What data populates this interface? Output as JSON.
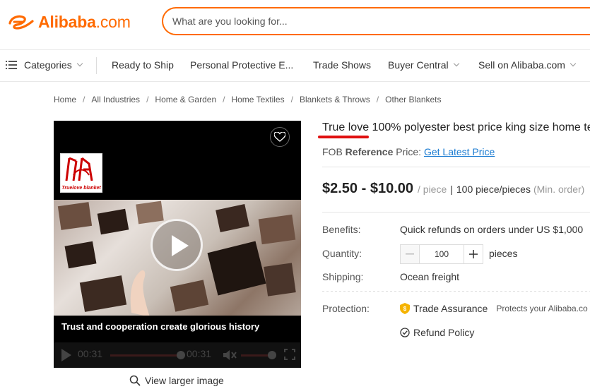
{
  "header": {
    "logo_text": "Alibaba",
    "logo_suffix": ".com",
    "search_placeholder": "What are you looking for..."
  },
  "nav": {
    "categories": "Categories",
    "items": [
      "Ready to Ship",
      "Personal Protective E...",
      "Trade Shows",
      "Buyer Central",
      "Sell on Alibaba.com"
    ]
  },
  "breadcrumb": [
    "Home",
    "All Industries",
    "Home & Garden",
    "Home Textiles",
    "Blankets & Throws",
    "Other Blankets"
  ],
  "media": {
    "brand_label": "Truelove blanket",
    "caption": "Trust and cooperation create glorious history",
    "time_current": "00:31",
    "time_total": "00:31",
    "progress": 1.0,
    "view_larger": "View larger image"
  },
  "product": {
    "title": "True love 100% polyester best price king size home te",
    "fob_prefix": "FOB",
    "fob_reference": "Reference",
    "fob_price_label": "Price:",
    "fob_link": "Get Latest Price",
    "price_range": "$2.50 - $10.00",
    "price_unit": "/ piece",
    "min_order_sep": "|",
    "min_order": "100 piece/pieces",
    "min_order_suffix": "(Min. order)",
    "benefits_label": "Benefits:",
    "benefits_value": "Quick refunds on orders under US $1,000",
    "quantity_label": "Quantity:",
    "quantity_value": "100",
    "quantity_unit": "pieces",
    "shipping_label": "Shipping:",
    "shipping_value": "Ocean freight",
    "protection_label": "Protection:",
    "trade_assurance": "Trade Assurance",
    "trade_assurance_note": "Protects your Alibaba.co",
    "refund_policy": "Refund Policy"
  },
  "colors": {
    "accent": "#ff6a00",
    "link": "#1a7bd1",
    "highlight": "#e01010"
  }
}
